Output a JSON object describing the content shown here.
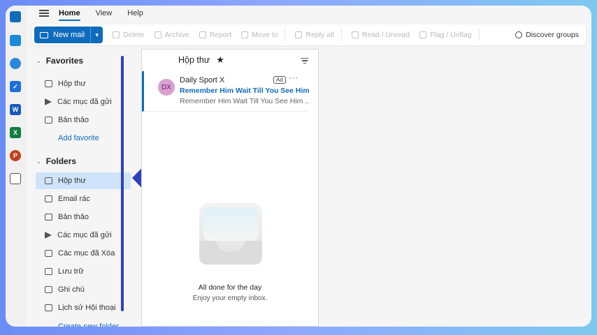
{
  "topbar": {
    "tabs": [
      {
        "label": "Home"
      },
      {
        "label": "View"
      },
      {
        "label": "Help"
      }
    ]
  },
  "ribbon": {
    "new_mail": "New mail",
    "delete": "Delete",
    "archive": "Archive",
    "report": "Report",
    "move_to": "Move to",
    "reply_all": "Reply all",
    "read_unread": "Read / Unread",
    "flag_unflag": "Flag / Unflag",
    "discover_groups": "Discover groups"
  },
  "favorites": {
    "title": "Favorites",
    "items": [
      {
        "label": "Hộp thư"
      },
      {
        "label": "Các mục đã gửi"
      },
      {
        "label": "Bản thảo"
      }
    ],
    "add": "Add favorite"
  },
  "folders": {
    "title": "Folders",
    "items": [
      {
        "label": "Hộp thư"
      },
      {
        "label": "Email rác"
      },
      {
        "label": "Bản thảo"
      },
      {
        "label": "Các mục đã gửi"
      },
      {
        "label": "Các mục đã Xóa"
      },
      {
        "label": "Lưu trữ"
      },
      {
        "label": "Ghi chú"
      },
      {
        "label": "Lịch sử Hội thoại"
      }
    ],
    "create": "Create new folder"
  },
  "message_list": {
    "title": "Hộp thư",
    "messages": [
      {
        "initials": "DX",
        "sender": "Daily Sport X",
        "badge": "Ad",
        "subject": "Remember Him Wait Till You See Him N",
        "preview": "Remember Him Wait Till You See Him ..."
      }
    ],
    "empty_title": "All done for the day",
    "empty_subtitle": "Enjoy your empty inbox."
  },
  "colors": {
    "accent": "#0f6cbd",
    "selected": "#cfe4fa",
    "annotation": "#2f3fbf"
  }
}
